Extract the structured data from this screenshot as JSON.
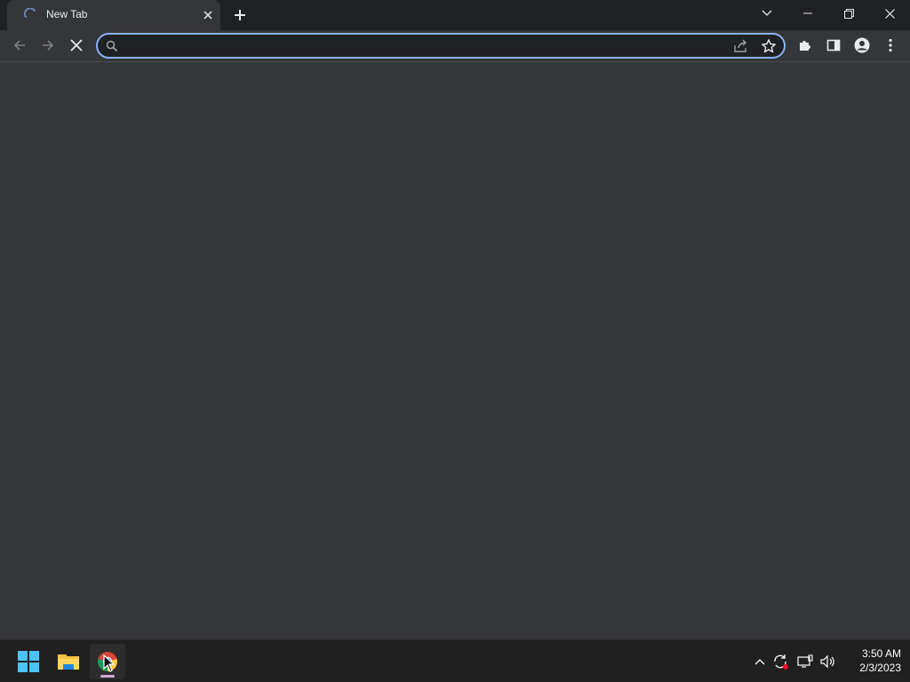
{
  "browser": {
    "tab": {
      "title": "New Tab",
      "loading": true
    },
    "omnibox": {
      "value": "",
      "placeholder": ""
    }
  },
  "taskbar": {
    "apps": [
      {
        "name": "Start",
        "icon": "windows-logo-icon"
      },
      {
        "name": "File Explorer",
        "icon": "folder-icon"
      },
      {
        "name": "Google Chrome",
        "icon": "chrome-icon",
        "active": true
      }
    ],
    "clock": {
      "time": "3:50 AM",
      "date": "2/3/2023"
    }
  },
  "colors": {
    "frame": "#202124",
    "toolbar": "#35363a",
    "focus_ring": "#8ab4f8",
    "taskbar": "#202020"
  }
}
